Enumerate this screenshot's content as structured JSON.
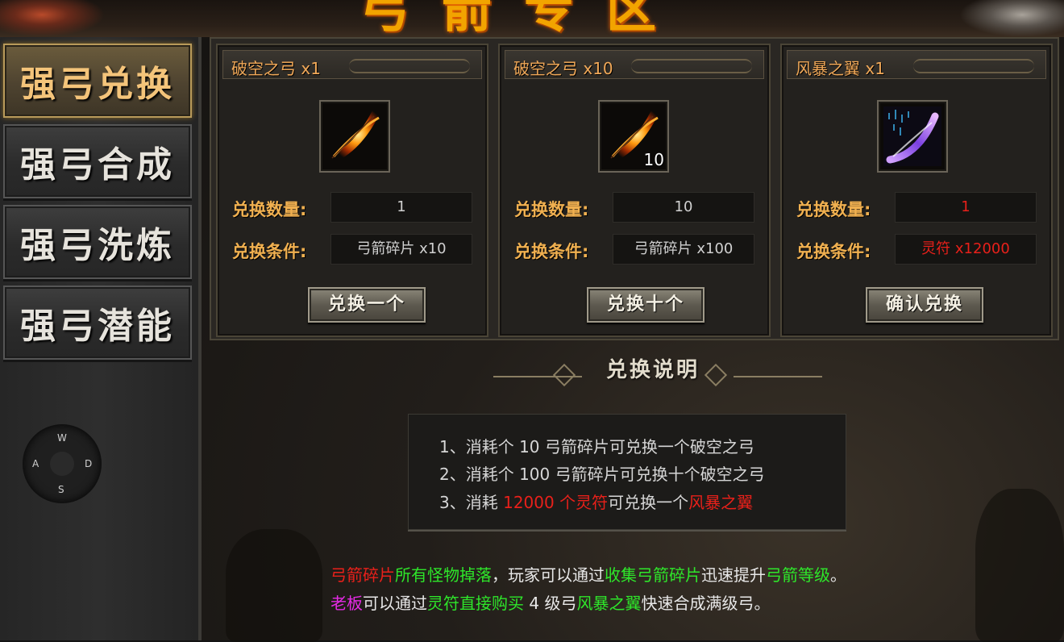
{
  "header": {
    "title": "弓箭专区"
  },
  "sidebar": {
    "items": [
      {
        "label": "强弓兑换",
        "active": true
      },
      {
        "label": "强弓合成",
        "active": false
      },
      {
        "label": "强弓洗炼",
        "active": false
      },
      {
        "label": "强弓潜能",
        "active": false
      }
    ],
    "joystick": {
      "up": "W",
      "left": "A",
      "right": "D",
      "down": "S"
    }
  },
  "cards": [
    {
      "title": "破空之弓 x1",
      "item_icon": "flame-bow-icon",
      "item_count": "",
      "quantity_label": "兑换数量:",
      "quantity_value": "1",
      "condition_label": "兑换条件:",
      "condition_value": "弓箭碎片 x10",
      "button_label": "兑换一个"
    },
    {
      "title": "破空之弓 x10",
      "item_icon": "flame-bow-icon",
      "item_count": "10",
      "quantity_label": "兑换数量:",
      "quantity_value": "10",
      "condition_label": "兑换条件:",
      "condition_value": "弓箭碎片 x100",
      "button_label": "兑换十个"
    },
    {
      "title": "风暴之翼 x1",
      "item_icon": "storm-bow-icon",
      "item_count": "",
      "quantity_label": "兑换数量:",
      "quantity_value": "1",
      "condition_label": "兑换条件:",
      "condition_value": "灵符 x12000",
      "button_label": "确认兑换"
    }
  ],
  "explanation": {
    "title": "兑换说明",
    "rules": [
      {
        "text": "1、消耗个 10 弓箭碎片可兑换一个破空之弓"
      },
      {
        "text": "2、消耗个 100 弓箭碎片可兑换十个破空之弓"
      },
      {
        "prefix": "3、消耗 ",
        "highlight1": "12000 个灵符",
        "middle": "可兑换一个",
        "highlight2": "风暴之翼"
      }
    ]
  },
  "footer": {
    "line1": {
      "part1": "弓箭碎片",
      "part2": "所有怪物掉落",
      "part3": "，玩家可以通过",
      "part4": "收集弓箭碎片",
      "part5": "迅速提升",
      "part6": "弓箭等级",
      "part7": "。"
    },
    "line2": {
      "part1": "老板",
      "part2": "可以通过",
      "part3": "灵符直接购买",
      "part4": " 4 级弓",
      "part5": "风暴之翼",
      "part6": "快速合成满级弓。"
    }
  },
  "colors": {
    "accent_gold": "#f0b050",
    "highlight_red": "#e8201a",
    "highlight_green": "#2ee62a",
    "highlight_magenta": "#e62ae6"
  }
}
